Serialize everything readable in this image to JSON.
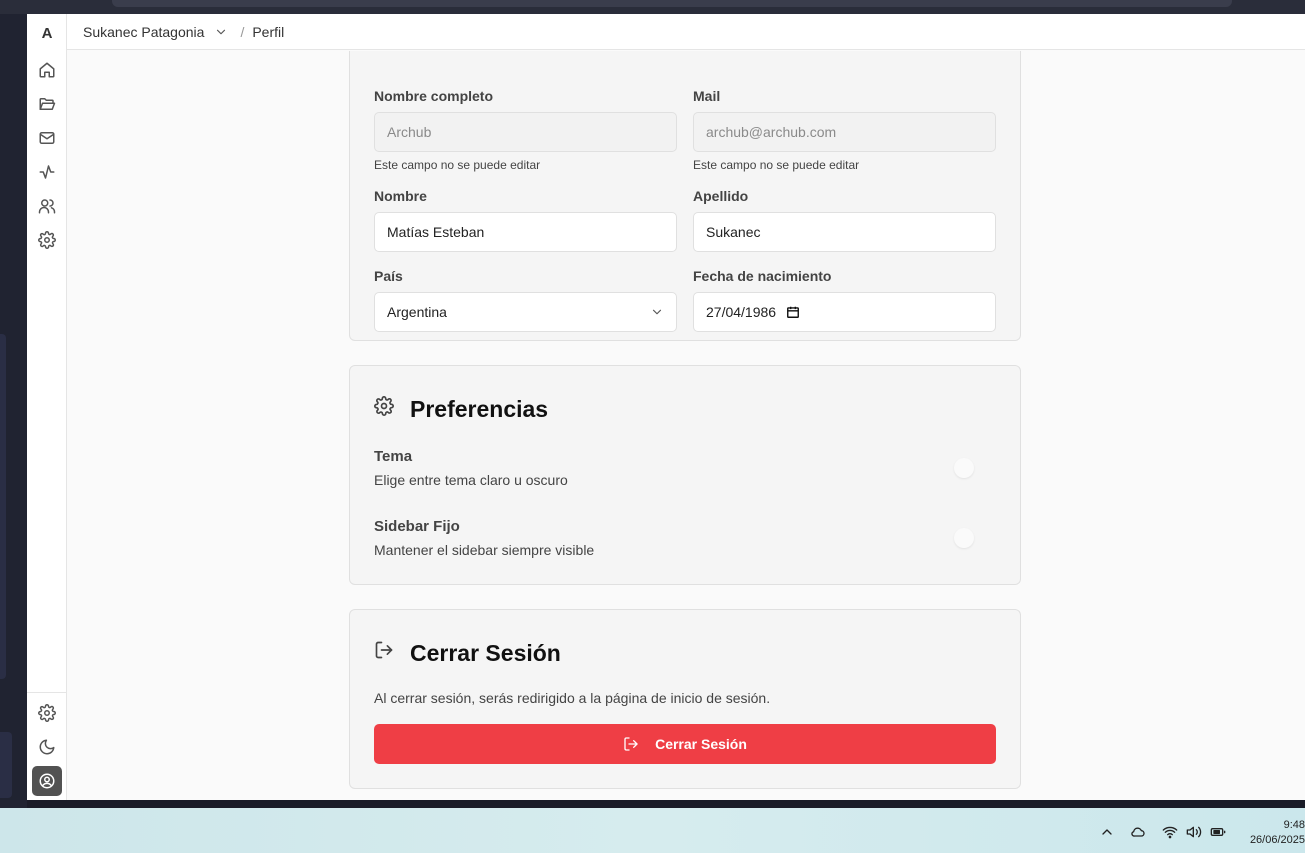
{
  "app": {
    "logo": "A"
  },
  "breadcrumb": {
    "organization": "Sukanec Patagonia",
    "separator": "/",
    "page": "Perfil"
  },
  "personal": {
    "full_name_label": "Nombre completo",
    "full_name_value": "Archub",
    "full_name_help": "Este campo no se puede editar",
    "mail_label": "Mail",
    "mail_value": "archub@archub.com",
    "mail_help": "Este campo no se puede editar",
    "first_name_label": "Nombre",
    "first_name_value": "Matías Esteban",
    "last_name_label": "Apellido",
    "last_name_value": "Sukanec",
    "country_label": "País",
    "country_value": "Argentina",
    "birth_label": "Fecha de nacimiento",
    "birth_value": "27/04/1986"
  },
  "preferences": {
    "title": "Preferencias",
    "theme_title": "Tema",
    "theme_desc": "Elige entre tema claro u oscuro",
    "sidebar_title": "Sidebar Fijo",
    "sidebar_desc": "Mantener el sidebar siempre visible"
  },
  "logout": {
    "title": "Cerrar Sesión",
    "desc": "Al cerrar sesión, serás redirigido a la página de inicio de sesión.",
    "button": "Cerrar Sesión"
  },
  "taskbar": {
    "time": "9:48",
    "date": "26/06/2025"
  },
  "colors": {
    "danger": "#ef3e45",
    "active_nav": "#525252"
  }
}
